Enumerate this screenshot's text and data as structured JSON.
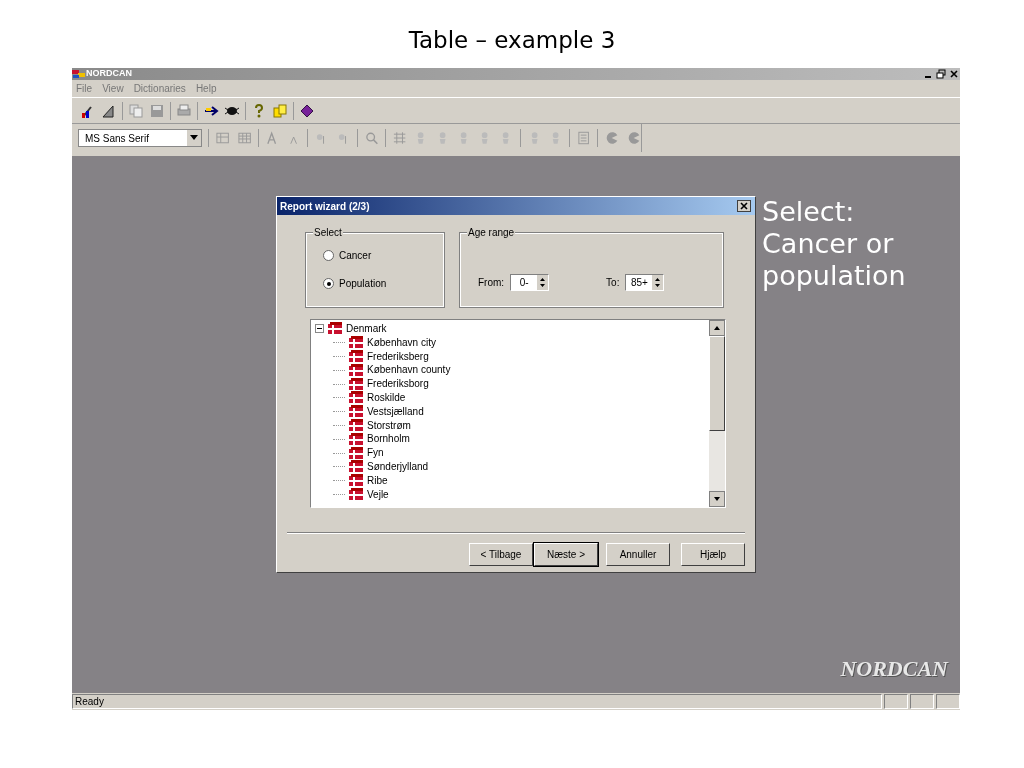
{
  "slide": {
    "title": "Table – example 3",
    "annotation": "Select: Cancer or population"
  },
  "window": {
    "title": "NORDCAN",
    "menu": [
      "File",
      "View",
      "Dictionaries",
      "Help"
    ],
    "font_select": {
      "value": "MS Sans Serif"
    },
    "logo_text": "NORDCAN",
    "status_bar": {
      "text": "Ready"
    }
  },
  "dialog": {
    "title": "Report wizard (2/3)",
    "select_group": {
      "label": "Select",
      "options": [
        {
          "label": "Cancer",
          "selected": false
        },
        {
          "label": "Population",
          "selected": true
        }
      ]
    },
    "age_range": {
      "label": "Age range",
      "from_label": "From:",
      "from_value": "0-",
      "to_label": "To:",
      "to_value": "85+"
    },
    "tree": {
      "label": "Denmark",
      "expanded": true,
      "children": [
        {
          "label": "København city"
        },
        {
          "label": "Frederiksberg"
        },
        {
          "label": "København county"
        },
        {
          "label": "Frederiksborg"
        },
        {
          "label": "Roskilde"
        },
        {
          "label": "Vestsjælland"
        },
        {
          "label": "Storstrøm"
        },
        {
          "label": "Bornholm"
        },
        {
          "label": "Fyn"
        },
        {
          "label": "Sønderjylland"
        },
        {
          "label": "Ribe"
        },
        {
          "label": "Vejle"
        }
      ]
    },
    "buttons": [
      {
        "label": "< Tilbage",
        "default": false
      },
      {
        "label": "Næste >",
        "default": true
      },
      {
        "label": "Annuller",
        "default": false
      },
      {
        "label": "Hjælp",
        "default": false
      }
    ]
  }
}
